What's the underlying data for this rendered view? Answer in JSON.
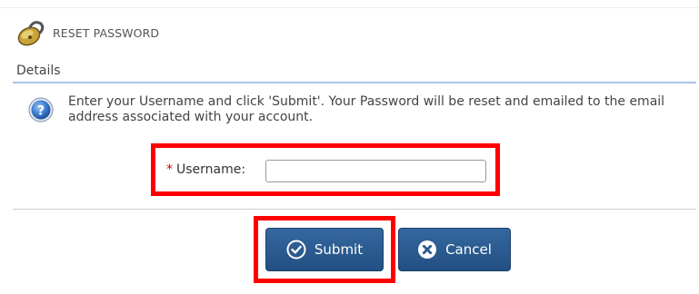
{
  "header": {
    "title": "RESET PASSWORD",
    "icon": "lock-icon"
  },
  "section": {
    "title": "Details"
  },
  "info": {
    "icon": "help-icon",
    "text": "Enter your Username and click 'Submit'. Your Password will be reset and emailed to the email address associated with your account."
  },
  "form": {
    "username": {
      "required_marker": "*",
      "label": "Username:",
      "value": "",
      "placeholder": ""
    }
  },
  "actions": {
    "submit_label": "Submit",
    "submit_icon": "check-circle-icon",
    "cancel_label": "Cancel",
    "cancel_icon": "x-circle-icon"
  },
  "colors": {
    "button": "#2b5a8f",
    "highlight": "#ff0000",
    "section_rule": "#a9c6e6"
  }
}
